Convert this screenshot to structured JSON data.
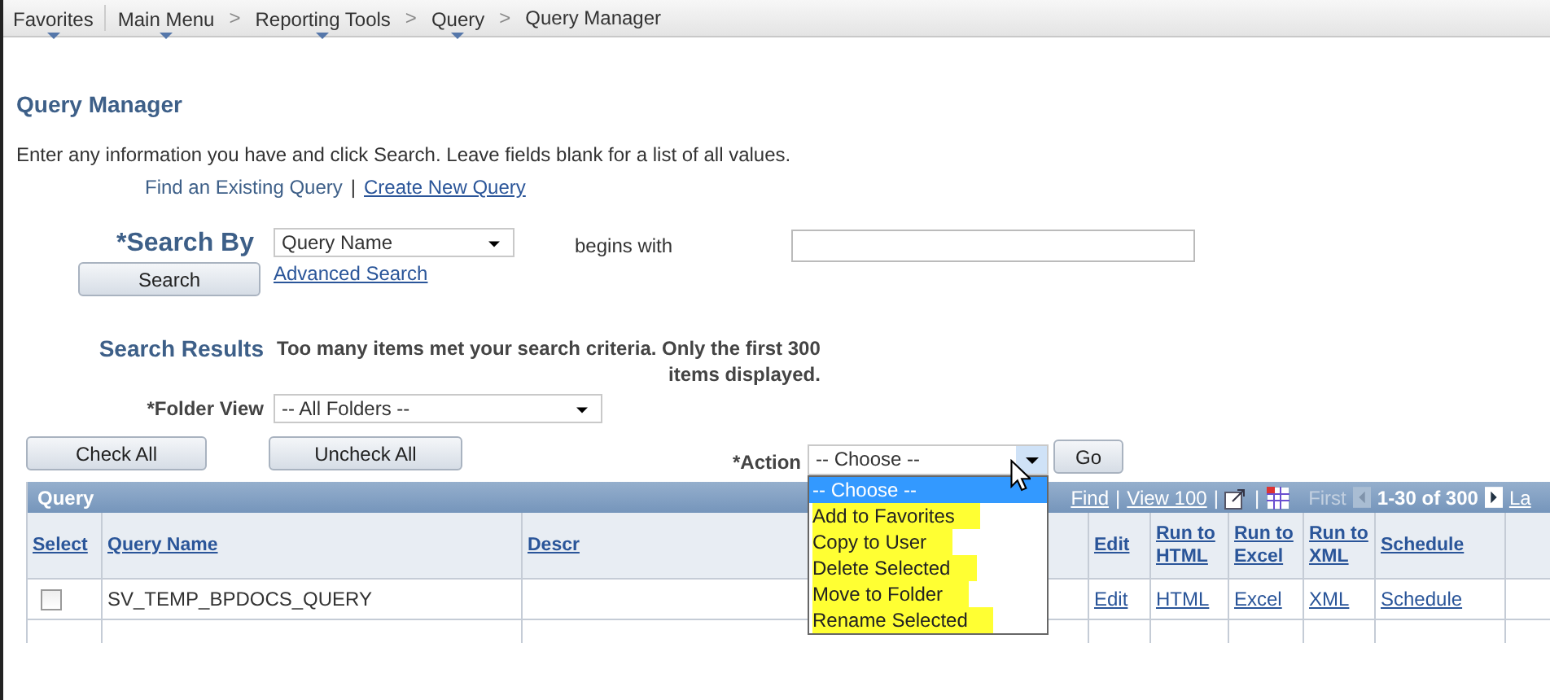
{
  "breadcrumb": [
    {
      "label": "Favorites",
      "menu": true
    },
    {
      "label": "Main Menu",
      "menu": true
    },
    {
      "label": "Reporting Tools",
      "menu": true,
      "separator": ">"
    },
    {
      "label": "Query",
      "menu": true,
      "separator": ">"
    },
    {
      "label": "Query Manager",
      "menu": false,
      "separator": ">"
    }
  ],
  "page_title": "Query Manager",
  "instructions": "Enter any information you have and click Search. Leave fields blank for a list of all values.",
  "links": [
    {
      "label": "Find an Existing Query",
      "kind": "current"
    },
    {
      "label": "|",
      "kind": "separator"
    },
    {
      "label": "Create New Query",
      "kind": "link"
    }
  ],
  "search": {
    "label": "*Search By",
    "field": {
      "value": "Query Name"
    },
    "operator": "begins with",
    "button": "Search",
    "advanced_link": "Advanced Search"
  },
  "results": {
    "label": "Search Results",
    "message_lines": [
      "Too many items met your search criteria. Only the first 300",
      "items displayed."
    ]
  },
  "folder_view": {
    "label": "*Folder View",
    "value": "-- All Folders --"
  },
  "buttons": [
    "Check All",
    "Uncheck All"
  ],
  "action": {
    "label": "*Action",
    "value": "-- Choose --",
    "expanded": true,
    "go": "Go",
    "options": [
      {
        "label": "-- Choose --",
        "selected": true,
        "highlighted": false
      },
      {
        "label": "Add to Favorites",
        "selected": false,
        "highlighted": true
      },
      {
        "label": "Copy to User",
        "selected": false,
        "highlighted": true
      },
      {
        "label": "Delete Selected",
        "selected": false,
        "highlighted": true
      },
      {
        "label": "Move to Folder",
        "selected": false,
        "highlighted": true
      },
      {
        "label": "Rename Selected",
        "selected": false,
        "highlighted": true
      }
    ]
  },
  "grid": {
    "title": "Query",
    "pager": {
      "find": "Find",
      "separator": "|",
      "view": "View 100",
      "first": "First",
      "range": "1-30 of 300",
      "last": "La"
    },
    "columns": [
      {
        "label": "Select",
        "kind": "checkbox"
      },
      {
        "label": "Query Name",
        "kind": "text"
      },
      {
        "label": "Descr",
        "kind": "text"
      },
      {
        "label": "Edit",
        "kind": "link"
      },
      {
        "label": "Run to HTML",
        "kind": "link"
      },
      {
        "label": "Run to Excel",
        "kind": "link"
      },
      {
        "label": "Run to XML",
        "kind": "link"
      },
      {
        "label": "Schedule",
        "kind": "link"
      }
    ],
    "rows": [
      {
        "checked": false,
        "cells": [
          null,
          "SV_TEMP_BPDOCS_QUERY",
          null,
          "Edit",
          "HTML",
          "Excel",
          "XML",
          "Schedule"
        ]
      }
    ]
  }
}
